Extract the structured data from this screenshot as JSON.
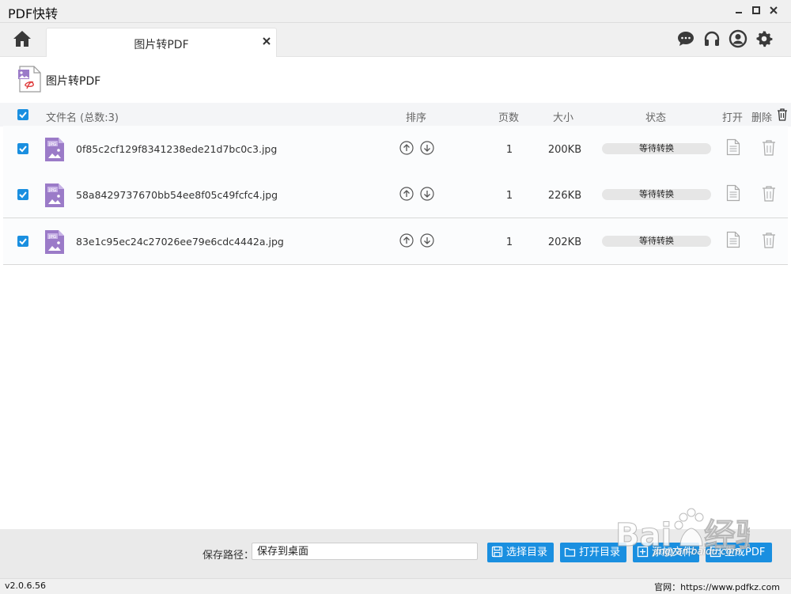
{
  "app": {
    "title": "PDF快转"
  },
  "tab": {
    "label": "图片转PDF"
  },
  "section": {
    "title": "图片转PDF"
  },
  "table": {
    "headers": {
      "filename": "文件名 (总数:3)",
      "sort": "排序",
      "pages": "页数",
      "size": "大小",
      "status": "状态",
      "open": "打开",
      "delete": "删除"
    },
    "rows": [
      {
        "filename": "0f85c2cf129f8341238ede21d7bc0c3.jpg",
        "pages": "1",
        "size": "200KB",
        "status": "等待转换",
        "checked": true
      },
      {
        "filename": "58a8429737670bb54ee8f05c49fcfc4.jpg",
        "pages": "1",
        "size": "226KB",
        "status": "等待转换",
        "checked": true
      },
      {
        "filename": "83e1c95ec24c27026ee79e6cdc4442a.jpg",
        "pages": "1",
        "size": "202KB",
        "status": "等待转换",
        "checked": true
      }
    ]
  },
  "bottom": {
    "save_label": "保存路径：",
    "save_value": "保存到桌面",
    "buttons": {
      "choose_dir": "选择目录",
      "open_dir": "打开目录",
      "add_file": "添加文件",
      "generate": "生成PDF"
    }
  },
  "statusbar": {
    "version": "v2.0.6.56",
    "site": "官网：https://www.pdfkz.com"
  },
  "watermark": {
    "text": "jingyan.baidu.com"
  },
  "colors": {
    "accent": "#1a8fe0",
    "icon_purple": "#9b7bc8"
  }
}
